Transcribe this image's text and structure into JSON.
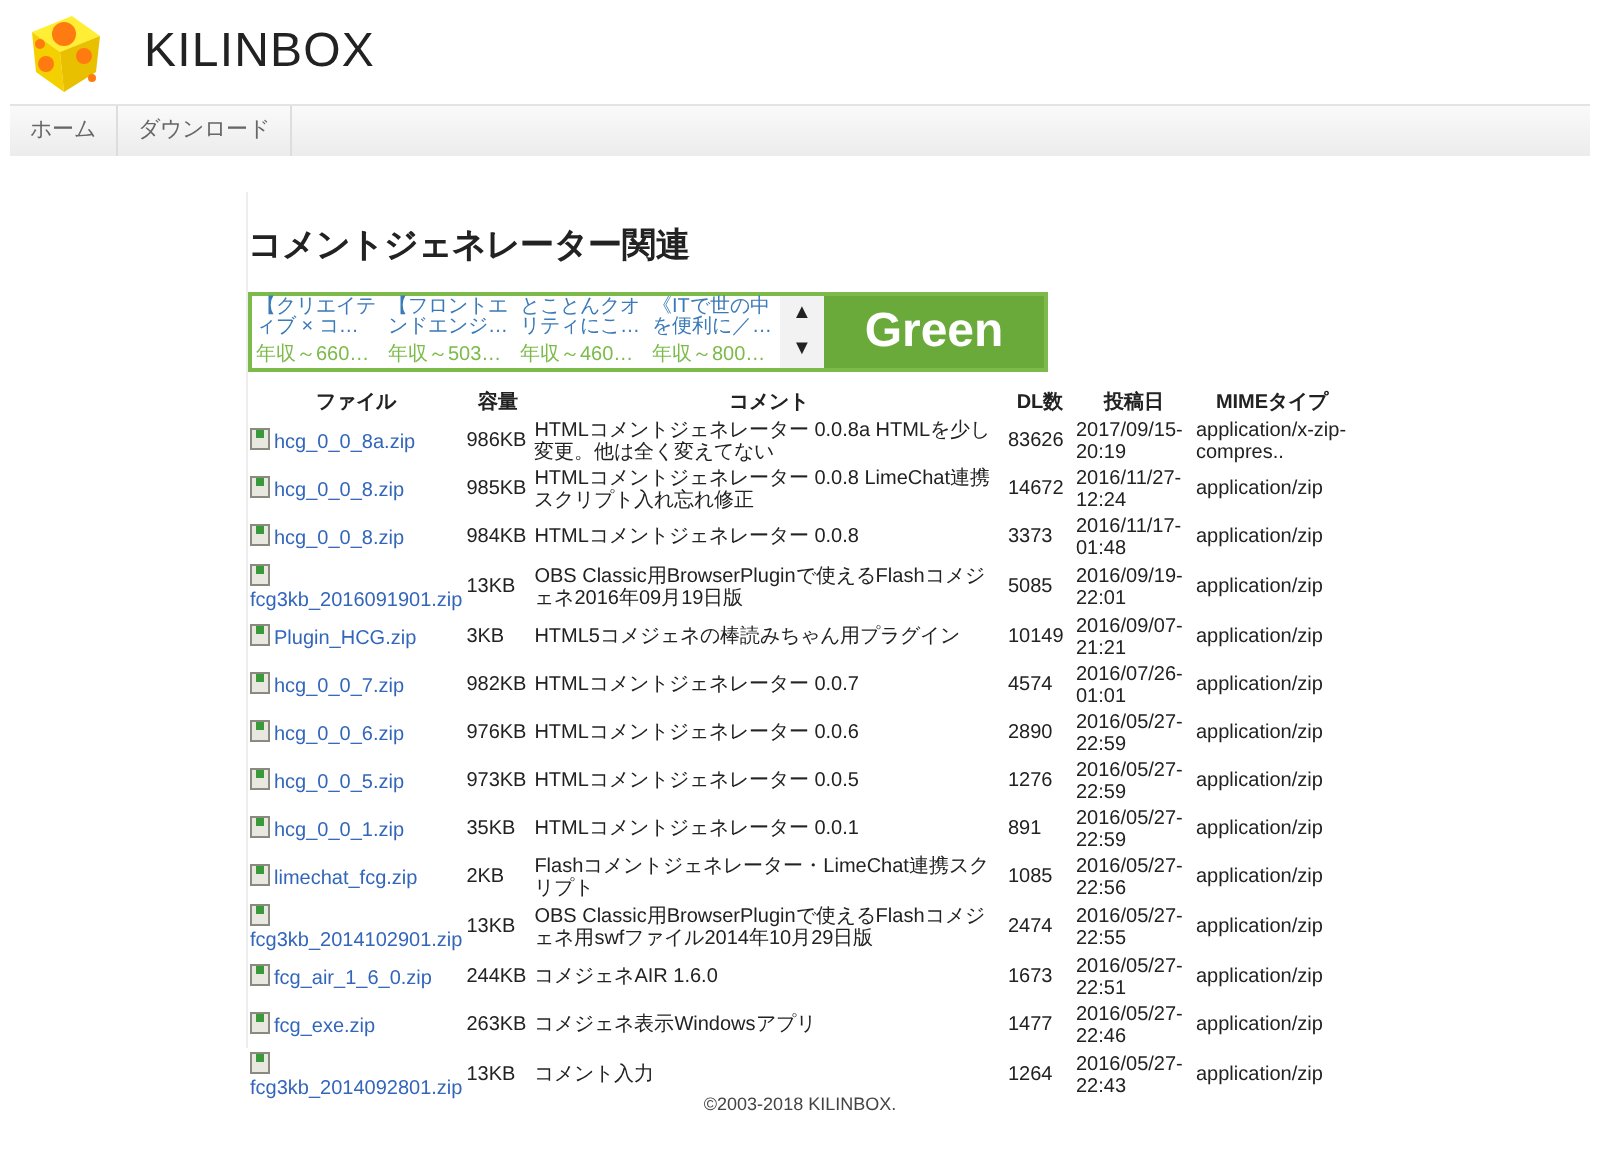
{
  "site": {
    "name": "KILINBOX"
  },
  "nav": [
    {
      "label": "ホーム"
    },
    {
      "label": "ダウンロード"
    }
  ],
  "page": {
    "title": "コメントジェネレーター関連"
  },
  "ad": {
    "items": [
      {
        "title": "【クリエイティブ × コ…",
        "salary": "年収～660…"
      },
      {
        "title": "【フロントエンドエンジ…",
        "salary": "年収～503…"
      },
      {
        "title": "とことんクオリティにこ…",
        "salary": "年収～460…"
      },
      {
        "title": "《ITで世の中を便利に／…",
        "salary": "年収～800…"
      }
    ],
    "up": "▲",
    "down": "▼",
    "brand": "Green"
  },
  "table": {
    "columns": [
      "ファイル",
      "容量",
      "コメント",
      "DL数",
      "投稿日",
      "MIMEタイプ"
    ],
    "rows": [
      [
        "hcg_0_0_8a.zip",
        "986KB",
        "HTMLコメントジェネレーター 0.0.8a HTMLを少し変更。他は全く変えてない",
        "83626",
        "2017/09/15-20:19",
        "application/x-zip-compres.."
      ],
      [
        "hcg_0_0_8.zip",
        "985KB",
        "HTMLコメントジェネレーター 0.0.8 LimeChat連携スクリプト入れ忘れ修正",
        "14672",
        "2016/11/27-12:24",
        "application/zip"
      ],
      [
        "hcg_0_0_8.zip",
        "984KB",
        "HTMLコメントジェネレーター 0.0.8",
        "3373",
        "2016/11/17-01:48",
        "application/zip"
      ],
      [
        "fcg3kb_2016091901.zip",
        "13KB",
        "OBS Classic用BrowserPluginで使えるFlashコメジェネ2016年09月19日版",
        "5085",
        "2016/09/19-22:01",
        "application/zip"
      ],
      [
        "Plugin_HCG.zip",
        "3KB",
        "HTML5コメジェネの棒読みちゃん用プラグイン",
        "10149",
        "2016/09/07-21:21",
        "application/zip"
      ],
      [
        "hcg_0_0_7.zip",
        "982KB",
        "HTMLコメントジェネレーター 0.0.7",
        "4574",
        "2016/07/26-01:01",
        "application/zip"
      ],
      [
        "hcg_0_0_6.zip",
        "976KB",
        "HTMLコメントジェネレーター 0.0.6",
        "2890",
        "2016/05/27-22:59",
        "application/zip"
      ],
      [
        "hcg_0_0_5.zip",
        "973KB",
        "HTMLコメントジェネレーター 0.0.5",
        "1276",
        "2016/05/27-22:59",
        "application/zip"
      ],
      [
        "hcg_0_0_1.zip",
        "35KB",
        "HTMLコメントジェネレーター 0.0.1",
        "891",
        "2016/05/27-22:59",
        "application/zip"
      ],
      [
        "limechat_fcg.zip",
        "2KB",
        "Flashコメントジェネレーター・LimeChat連携スクリプト",
        "1085",
        "2016/05/27-22:56",
        "application/zip"
      ],
      [
        "fcg3kb_2014102901.zip",
        "13KB",
        "OBS Classic用BrowserPluginで使えるFlashコメジェネ用swfファイル2014年10月29日版",
        "2474",
        "2016/05/27-22:55",
        "application/zip"
      ],
      [
        "fcg_air_1_6_0.zip",
        "244KB",
        "コメジェネAIR 1.6.0",
        "1673",
        "2016/05/27-22:51",
        "application/zip"
      ],
      [
        "fcg_exe.zip",
        "263KB",
        "コメジェネ表示Windowsアプリ",
        "1477",
        "2016/05/27-22:46",
        "application/zip"
      ],
      [
        "fcg3kb_2014092801.zip",
        "13KB",
        "コメント入力",
        "1264",
        "2016/05/27-22:43",
        "application/zip"
      ]
    ]
  },
  "footer": {
    "text": "©2003-2018 KILINBOX."
  }
}
